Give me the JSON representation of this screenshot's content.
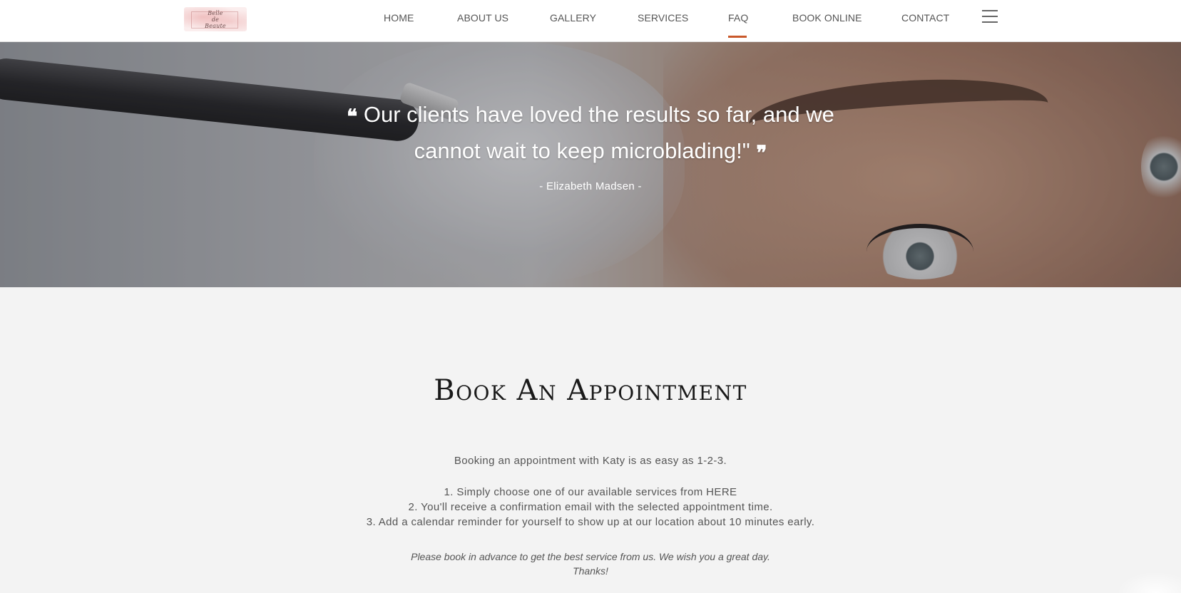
{
  "header": {
    "logo_lines": [
      "Belle",
      "de",
      "Beaute"
    ],
    "nav": [
      {
        "label": "HOME"
      },
      {
        "label": "ABOUT US"
      },
      {
        "label": "GALLERY"
      },
      {
        "label": "SERVICES"
      },
      {
        "label": "FAQ",
        "active": true
      },
      {
        "label": "BOOK ONLINE"
      },
      {
        "label": "CONTACT"
      }
    ],
    "accent_color": "#c9582a",
    "menu_icon": "hamburger-icon"
  },
  "hero": {
    "quote_open": "❝",
    "quote": "Our clients have loved the results so far, and we cannot wait to keep microblading!\"",
    "quote_close": "❞",
    "author": "- Elizabeth Madsen -"
  },
  "booking": {
    "title": "Book An Appointment",
    "intro": "Booking an appointment with Katy is as easy as 1-2-3.",
    "steps": [
      "1. Simply choose one of our available services from HERE",
      "2. You'll receive a confirmation email with the selected appointment time.",
      "3. Add a calendar reminder for yourself to show up at our location about 10 minutes early."
    ],
    "note_line1": "Please book in advance to get the best service from us. We wish you a great day.",
    "note_line2": "Thanks!"
  }
}
